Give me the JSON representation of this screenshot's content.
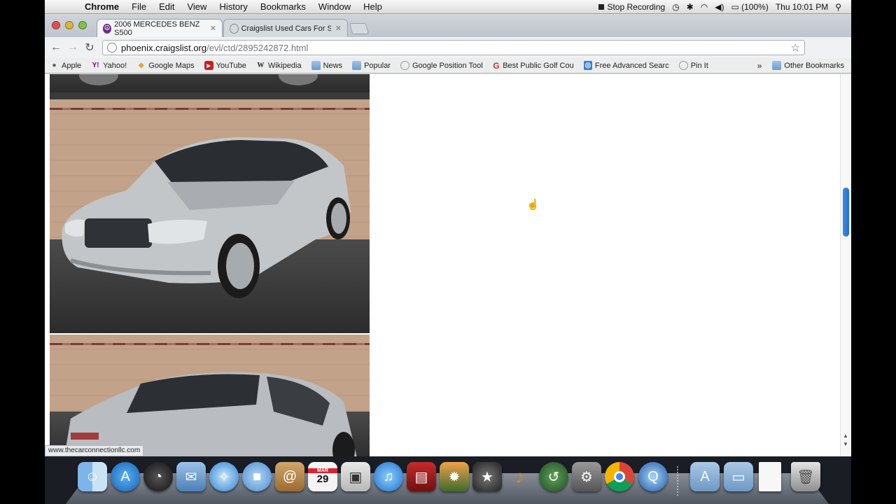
{
  "menubar": {
    "app_name": "Chrome",
    "menus": [
      "File",
      "Edit",
      "View",
      "History",
      "Bookmarks",
      "Window",
      "Help"
    ],
    "stop_recording": "Stop Recording",
    "battery": "(100%)",
    "clock": "Thu 10:01 PM"
  },
  "tabs": [
    {
      "title": "2006 MERCEDES BENZ S500",
      "active": true
    },
    {
      "title": "Craigslist Used Cars For Sale",
      "active": false
    }
  ],
  "toolbar": {
    "url_host": "phoenix.craigslist.org",
    "url_path": "/evl/ctd/2895242872.html"
  },
  "bookmarks": {
    "items": [
      {
        "label": "Apple",
        "icon": "apple-icon"
      },
      {
        "label": "Yahoo!",
        "icon": "yahoo-icon"
      },
      {
        "label": "Google Maps",
        "icon": "maps-icon"
      },
      {
        "label": "YouTube",
        "icon": "youtube-icon"
      },
      {
        "label": "Wikipedia",
        "icon": "wikipedia-icon"
      },
      {
        "label": "News",
        "icon": "folder-icon"
      },
      {
        "label": "Popular",
        "icon": "folder-icon"
      },
      {
        "label": "Google Position Tool",
        "icon": "globe-icon"
      },
      {
        "label": "Best Public Golf Cou",
        "icon": "google-icon"
      },
      {
        "label": "Free Advanced Searc",
        "icon": "search-icon"
      },
      {
        "label": "Pin It",
        "icon": "globe-icon"
      }
    ],
    "more": "»",
    "other": "Other Bookmarks"
  },
  "status": {
    "link": "www.thecarconnectionllc.com"
  },
  "dock": {
    "apps": [
      "Finder",
      "App Store",
      "Dashboard",
      "Mail",
      "Safari",
      "FaceTime",
      "Address Book",
      "iCal",
      "Preview",
      "iTunes",
      "Photo Booth",
      "iPhoto",
      "iMovie",
      "GarageBand",
      "Time Machine",
      "System Preferences",
      "Chrome",
      "QuickTime",
      "Applications",
      "Documents",
      "Document",
      "Trash"
    ]
  },
  "calendar_day": "29",
  "calendar_month": "MAR"
}
